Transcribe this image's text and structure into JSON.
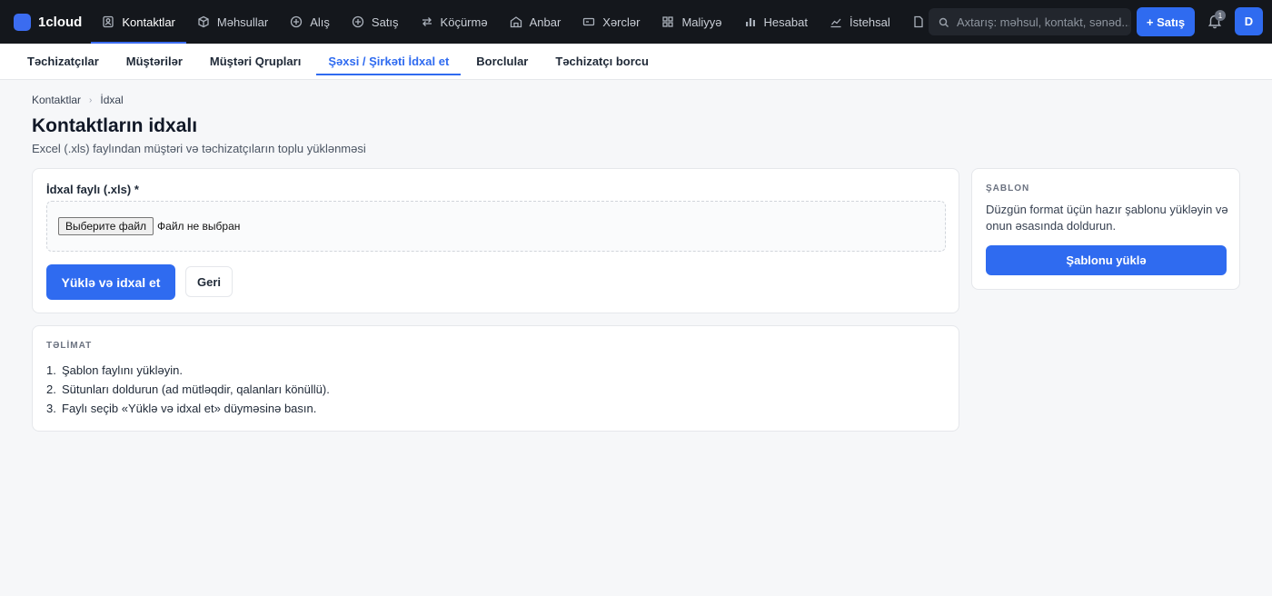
{
  "brand": {
    "name": "1cloud"
  },
  "nav": [
    {
      "label": "Kontaktlar",
      "icon": "contacts-icon",
      "active": true
    },
    {
      "label": "Məhsullar",
      "icon": "box-icon"
    },
    {
      "label": "Alış",
      "icon": "plus-circle-icon"
    },
    {
      "label": "Satış",
      "icon": "plus-circle-icon"
    },
    {
      "label": "Köçürmə",
      "icon": "transfer-icon"
    },
    {
      "label": "Anbar",
      "icon": "warehouse-icon"
    },
    {
      "label": "Xərclər",
      "icon": "wallet-icon"
    },
    {
      "label": "Maliyyə",
      "icon": "grid-icon"
    },
    {
      "label": "Hesabat",
      "icon": "bar-chart-icon"
    },
    {
      "label": "İstehsal",
      "icon": "line-chart-icon"
    }
  ],
  "search": {
    "placeholder": "Axtarış: məhsul, kontakt, sənəd..."
  },
  "header": {
    "sale_button": "+ Satış",
    "notifications_count": "1",
    "avatar_initial": "D"
  },
  "subnav": [
    {
      "label": "Təchizatçılar"
    },
    {
      "label": "Müştərilər"
    },
    {
      "label": "Müştəri Qrupları"
    },
    {
      "label": "Şəxsi / Şirkəti İdxal et",
      "active": true
    },
    {
      "label": "Borclular"
    },
    {
      "label": "Təchizatçı borcu"
    }
  ],
  "breadcrumb": {
    "parent": "Kontaktlar",
    "current": "İdxal"
  },
  "page": {
    "title": "Kontaktların idxalı",
    "subtitle": "Excel (.xls) faylından müştəri və təchizatçıların toplu yüklənməsi"
  },
  "upload": {
    "label": "İdxal faylı (.xls) *",
    "file_button": "Выберите файл",
    "file_status": "Файл не выбран",
    "submit": "Yüklə və idxal et",
    "back": "Geri"
  },
  "instructions": {
    "heading": "TƏLİMAT",
    "steps": [
      "Şablon faylını yükləyin.",
      "Sütunları doldurun (ad mütləqdir, qalanları könüllü).",
      "Faylı seçib «Yüklə və idxal et» düyməsinə basın."
    ]
  },
  "template": {
    "heading": "ŞABLON",
    "text": "Düzgün format üçün hazır şablonu yükləyin və onun əsasında doldurun.",
    "button": "Şablonu yüklə"
  },
  "colors": {
    "accent": "#2f6bf0",
    "topbar": "#14171c",
    "page_bg": "#f6f7f9"
  }
}
